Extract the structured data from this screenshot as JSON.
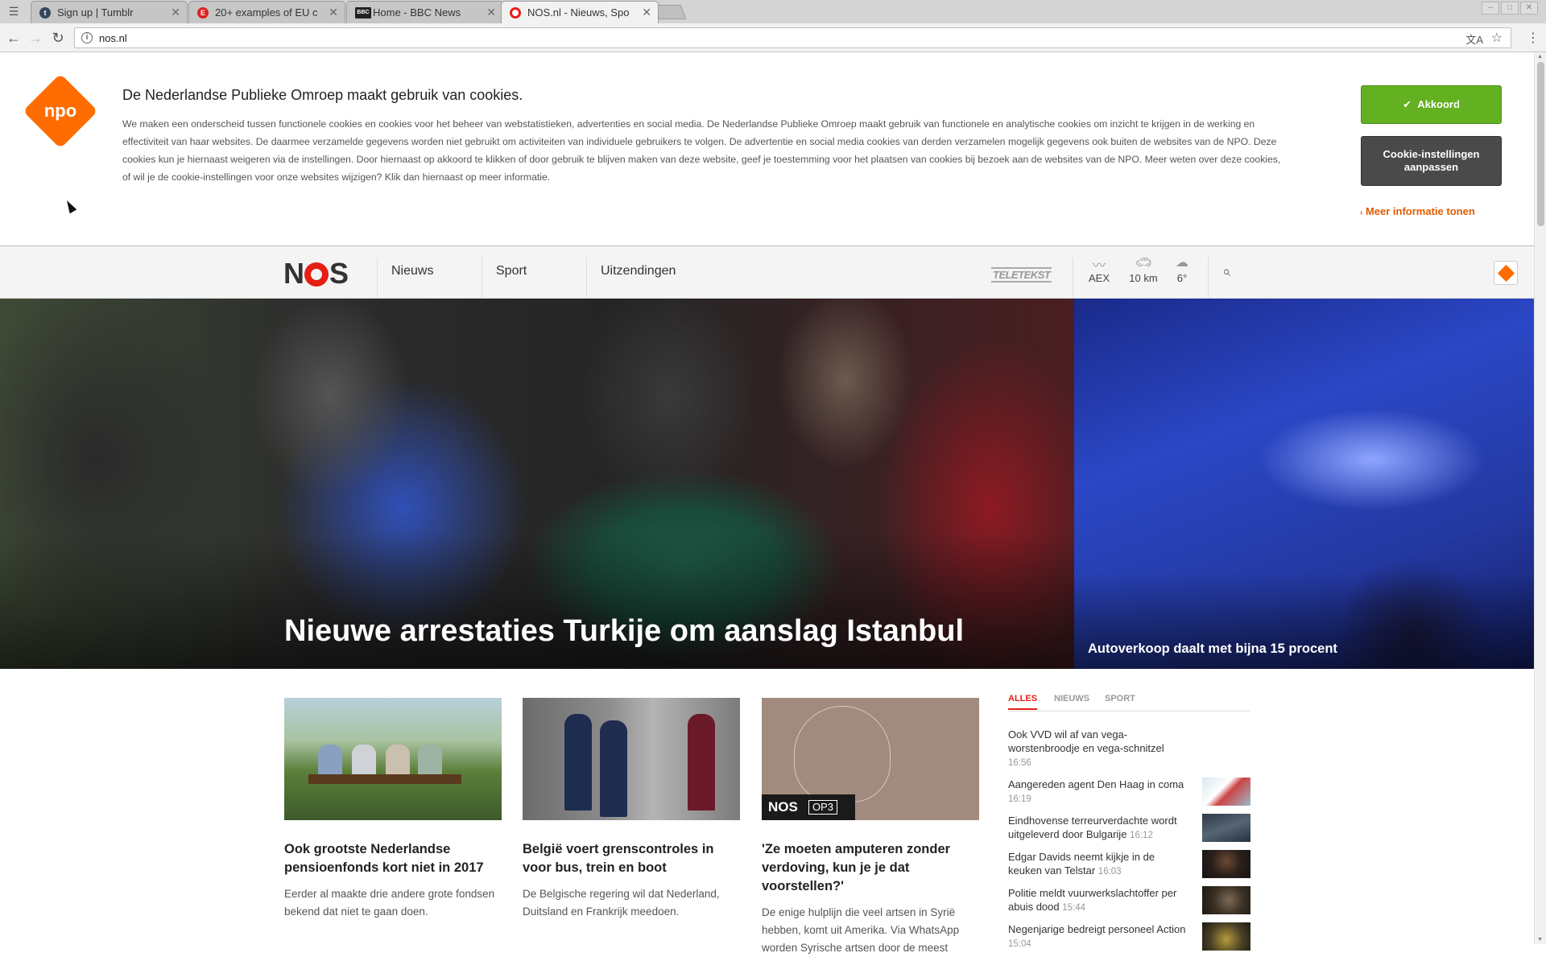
{
  "browser": {
    "tabs": [
      {
        "title": "Sign up | Tumblr",
        "fav": "t",
        "fav_color": "#35465c"
      },
      {
        "title": "20+ examples of EU c",
        "fav": "E",
        "fav_color": "#d9231f"
      },
      {
        "title": "Home - BBC News",
        "fav": "BBC",
        "fav_color": "#222222"
      },
      {
        "title": "NOS.nl - Nieuws, Spo",
        "fav": "",
        "fav_color": "#e61e14"
      }
    ],
    "url": "nos.nl"
  },
  "cookie": {
    "title": "De Nederlandse Publieke Omroep maakt gebruik van cookies.",
    "text": "We maken een onderscheid tussen functionele cookies en cookies voor het beheer van webstatistieken, advertenties en social media. De Nederlandse Publieke Omroep maakt gebruik van functionele en analytische cookies om inzicht te krijgen in de werking en effectiviteit van haar websites. De daarmee verzamelde gegevens worden niet gebruikt om activiteiten van individuele gebruikers te volgen. De advertentie en social media cookies van derden verzamelen mogelijk gegevens ook buiten de websites van de NPO. Deze cookies kun je hiernaast weigeren via de instellingen. Door hiernaast op akkoord te klikken of door gebruik te blijven maken van deze website, geef je toestemming voor het plaatsen van cookies bij bezoek aan de websites van de NPO. Meer weten over deze cookies, of wil je de cookie-instellingen voor onze websites wijzigen? Klik dan hiernaast op meer informatie.",
    "logo": "npo",
    "accept_label": "Akkoord",
    "settings_label_1": "Cookie-instellingen",
    "settings_label_2": "aanpassen",
    "more_info_label": "Meer informatie tonen"
  },
  "header": {
    "logo_left": "N",
    "logo_right": "S",
    "nav": [
      "Nieuws",
      "Sport",
      "Uitzendingen"
    ],
    "teletekst": "TELETEKST",
    "widgets": {
      "aex": "AEX",
      "traffic": "10 km",
      "weather": "6°"
    }
  },
  "hero": {
    "main_title": "Nieuwe arrestaties Turkije om aanslag Istanbul",
    "side_title": "Autoverkoop daalt met bijna 15 procent"
  },
  "articles": [
    {
      "title": "Ook grootste Nederlandse pensioenfonds kort niet in 2017",
      "text": "Eerder al maakte drie andere grote fondsen bekend dat niet te gaan doen."
    },
    {
      "title": "België voert grenscontroles in voor bus, trein en boot",
      "text": "De Belgische regering wil dat Nederland, Duitsland en Frankrijk meedoen."
    },
    {
      "title": "'Ze moeten amputeren zonder verdoving, kun je je dat voorstellen?'",
      "text": "De enige hulplijn die veel artsen in Syrië hebben, komt uit Amerika. Via WhatsApp worden Syrische artsen door de meest",
      "badge_nos": "NOS",
      "badge_op3": "OP3"
    }
  ],
  "latest": {
    "tabs": [
      "ALLES",
      "NIEUWS",
      "SPORT"
    ],
    "items": [
      {
        "title": "Ook VVD wil af van vega-worstenbroodje en vega-schnitzel",
        "time": "16:56"
      },
      {
        "title": "Aangereden agent Den Haag in coma",
        "time": "16:19"
      },
      {
        "title": "Eindhovense terreurverdachte wordt uitgeleverd door Bulgarije",
        "time": "16:12"
      },
      {
        "title": "Edgar Davids neemt kijkje in de keuken van Telstar",
        "time": "16:03"
      },
      {
        "title": "Politie meldt vuurwerkslachtoffer per abuis dood",
        "time": "15:44"
      },
      {
        "title": "Negenjarige bedreigt personeel Action",
        "time": "15:04"
      }
    ]
  },
  "colors": {
    "accent_red": "#e61e14",
    "npo_orange": "#ff6d00",
    "accept_green": "#63b021"
  }
}
